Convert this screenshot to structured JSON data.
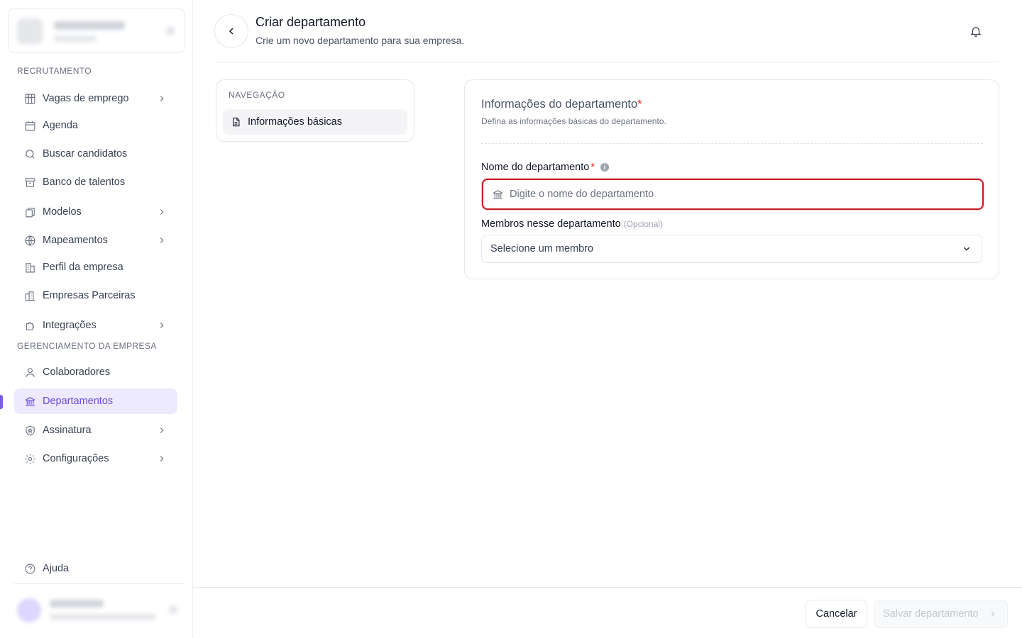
{
  "sidebar": {
    "sections": {
      "recruitment": "RECRUTAMENTO",
      "company": "GERENCIAMENTO DA EMPRESA"
    },
    "items": [
      {
        "label": "Vagas de emprego",
        "icon": "briefcase-icon",
        "has_chevron": true
      },
      {
        "label": "Agenda",
        "icon": "calendar-icon",
        "has_chevron": false
      },
      {
        "label": "Buscar candidatos",
        "icon": "search-icon",
        "has_chevron": false
      },
      {
        "label": "Banco de talentos",
        "icon": "archive-icon",
        "has_chevron": false
      },
      {
        "label": "Modelos",
        "icon": "copy-icon",
        "has_chevron": true
      },
      {
        "label": "Mapeamentos",
        "icon": "globe-icon",
        "has_chevron": true
      },
      {
        "label": "Perfil da empresa",
        "icon": "building-icon",
        "has_chevron": false
      },
      {
        "label": "Empresas Parceiras",
        "icon": "buildings-icon",
        "has_chevron": false
      },
      {
        "label": "Integrações",
        "icon": "puzzle-icon",
        "has_chevron": true
      },
      {
        "label": "Colaboradores",
        "icon": "user-icon",
        "has_chevron": false
      },
      {
        "label": "Departamentos",
        "icon": "bank-icon",
        "has_chevron": false,
        "active": true
      },
      {
        "label": "Assinatura",
        "icon": "shield-icon",
        "has_chevron": true
      },
      {
        "label": "Configurações",
        "icon": "gear-icon",
        "has_chevron": true
      }
    ],
    "help_label": "Ajuda",
    "active_color": "#6d4bd8"
  },
  "header": {
    "title": "Criar departamento",
    "subtitle": "Crie um novo departamento para sua empresa."
  },
  "nav_card": {
    "label": "NAVEGAÇÃO",
    "item": "Informações básicas"
  },
  "form": {
    "title": "Informações do departamento",
    "required_mark": "*",
    "description": "Defina as informações básicas do departamento.",
    "name_label": "Nome do departamento",
    "name_placeholder": "Digite o nome do departamento",
    "name_value": "",
    "members_label": "Membros nesse departamento",
    "members_optional": "(Opcional)",
    "members_value": "Selecione um membro",
    "error_border_color": "#c51d25"
  },
  "footer": {
    "cancel_label": "Cancelar",
    "save_label": "Salvar departamento"
  }
}
